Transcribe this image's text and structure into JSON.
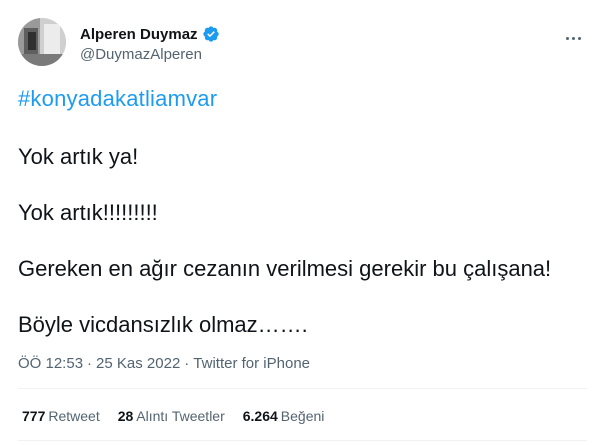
{
  "author": {
    "display_name": "Alperen Duymaz",
    "handle": "@DuymazAlperen",
    "verified": true,
    "avatar_icon": "profile-photo"
  },
  "tweet": {
    "hashtag": "#konyadakatliamvar",
    "paragraphs": [
      "Yok artık ya!",
      "Yok artık!!!!!!!!!",
      "Gereken en ağır cezanın verilmesi gerekir bu çalışana!",
      "Böyle vicdansızlık olmaz……."
    ]
  },
  "meta": {
    "time": "ÖÖ 12:53",
    "separator": "·",
    "date": "25 Kas 2022",
    "source": "Twitter for iPhone"
  },
  "stats": {
    "retweets_count": "777",
    "retweets_label": "Retweet",
    "quotes_count": "28",
    "quotes_label": "Alıntı Tweetler",
    "likes_count": "6.264",
    "likes_label": "Beğeni"
  },
  "colors": {
    "accent": "#1d9bf0",
    "secondary_text": "#536471",
    "divider": "#eff3f4"
  }
}
